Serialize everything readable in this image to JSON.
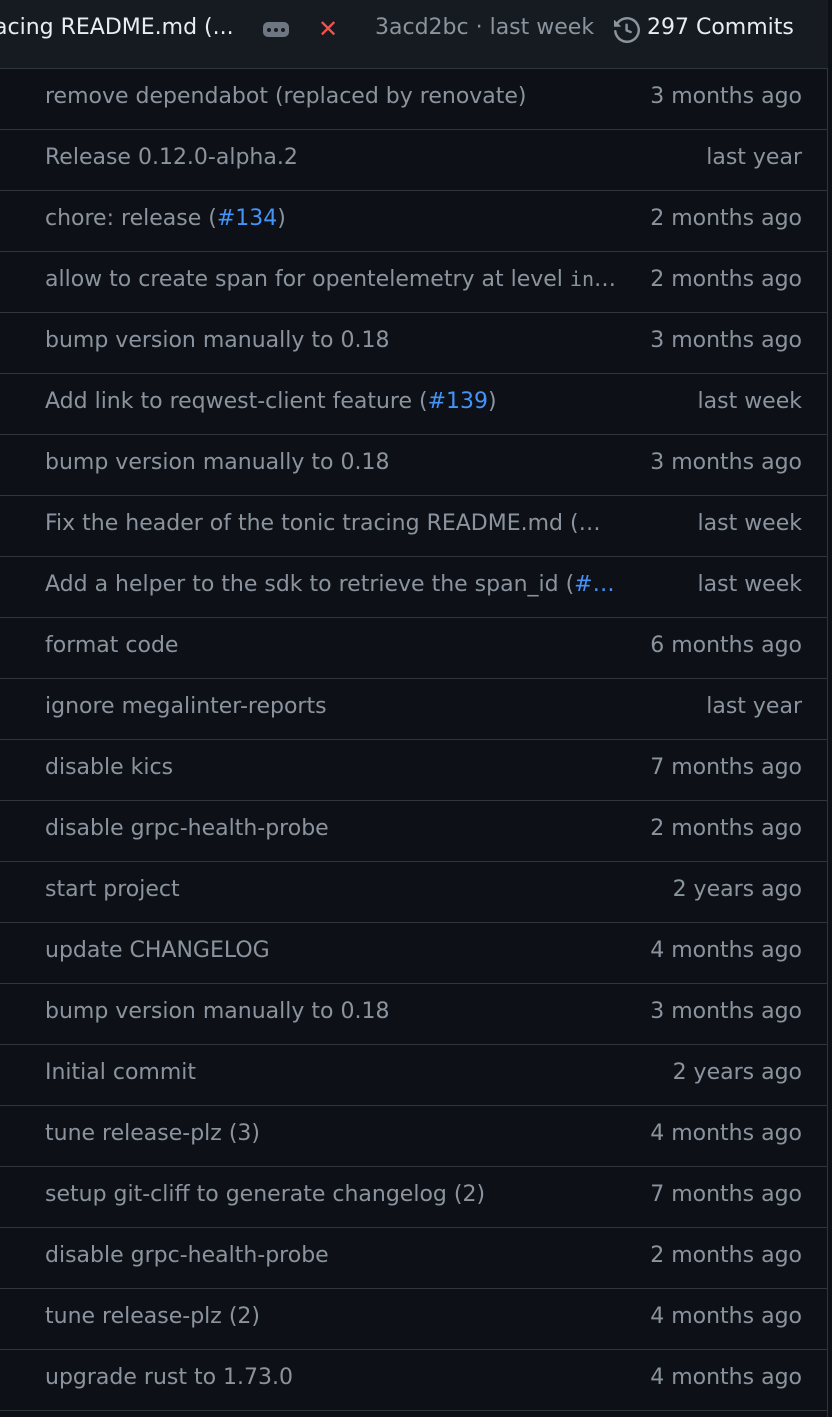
{
  "header": {
    "commit_message": "acing README.md (...",
    "commit_sha_time": "3acd2bc · last week",
    "commits_count": "297 Commits",
    "status_icon": "x-icon",
    "status_color": "#f85149"
  },
  "files": [
    {
      "msg_parts": [
        "remove dependabot (replaced by renovate)"
      ],
      "time": "3 months ago"
    },
    {
      "msg_parts": [
        "Release 0.12.0-alpha.2"
      ],
      "time": "last year"
    },
    {
      "msg_parts": [
        "chore: release (",
        "#134",
        ")"
      ],
      "time": "2 months ago"
    },
    {
      "msg_parts": [
        "allow to create span for opentelemetry at level ",
        "in",
        "…"
      ],
      "time": "2 months ago"
    },
    {
      "msg_parts": [
        "bump version manually to 0.18"
      ],
      "time": "3 months ago"
    },
    {
      "msg_parts": [
        "Add link to reqwest-client feature (",
        "#139",
        ")"
      ],
      "time": "last week"
    },
    {
      "msg_parts": [
        "bump version manually to 0.18"
      ],
      "time": "3 months ago"
    },
    {
      "msg_parts": [
        " Fix the header of the tonic tracing README.md (…"
      ],
      "time": "last week"
    },
    {
      "msg_parts": [
        "Add a helper to the sdk to retrieve the span_id (",
        "#…",
        ""
      ],
      "time": "last week"
    },
    {
      "msg_parts": [
        "format code"
      ],
      "time": "6 months ago"
    },
    {
      "msg_parts": [
        "ignore megalinter-reports"
      ],
      "time": "last year"
    },
    {
      "msg_parts": [
        "disable kics"
      ],
      "time": "7 months ago"
    },
    {
      "msg_parts": [
        "disable grpc-health-probe"
      ],
      "time": "2 months ago"
    },
    {
      "msg_parts": [
        "start project"
      ],
      "time": "2 years ago"
    },
    {
      "msg_parts": [
        "update CHANGELOG"
      ],
      "time": "4 months ago"
    },
    {
      "msg_parts": [
        "bump version manually to 0.18"
      ],
      "time": "3 months ago"
    },
    {
      "msg_parts": [
        "Initial commit"
      ],
      "time": "2 years ago"
    },
    {
      "msg_parts": [
        "tune release-plz (3)"
      ],
      "time": "4 months ago"
    },
    {
      "msg_parts": [
        "setup git-cliff to generate changelog (2)"
      ],
      "time": "7 months ago"
    },
    {
      "msg_parts": [
        "disable grpc-health-probe"
      ],
      "time": "2 months ago"
    },
    {
      "msg_parts": [
        "tune release-plz (2)"
      ],
      "time": "4 months ago"
    },
    {
      "msg_parts": [
        " upgrade rust to 1.73.0"
      ],
      "time": "4 months ago"
    }
  ]
}
